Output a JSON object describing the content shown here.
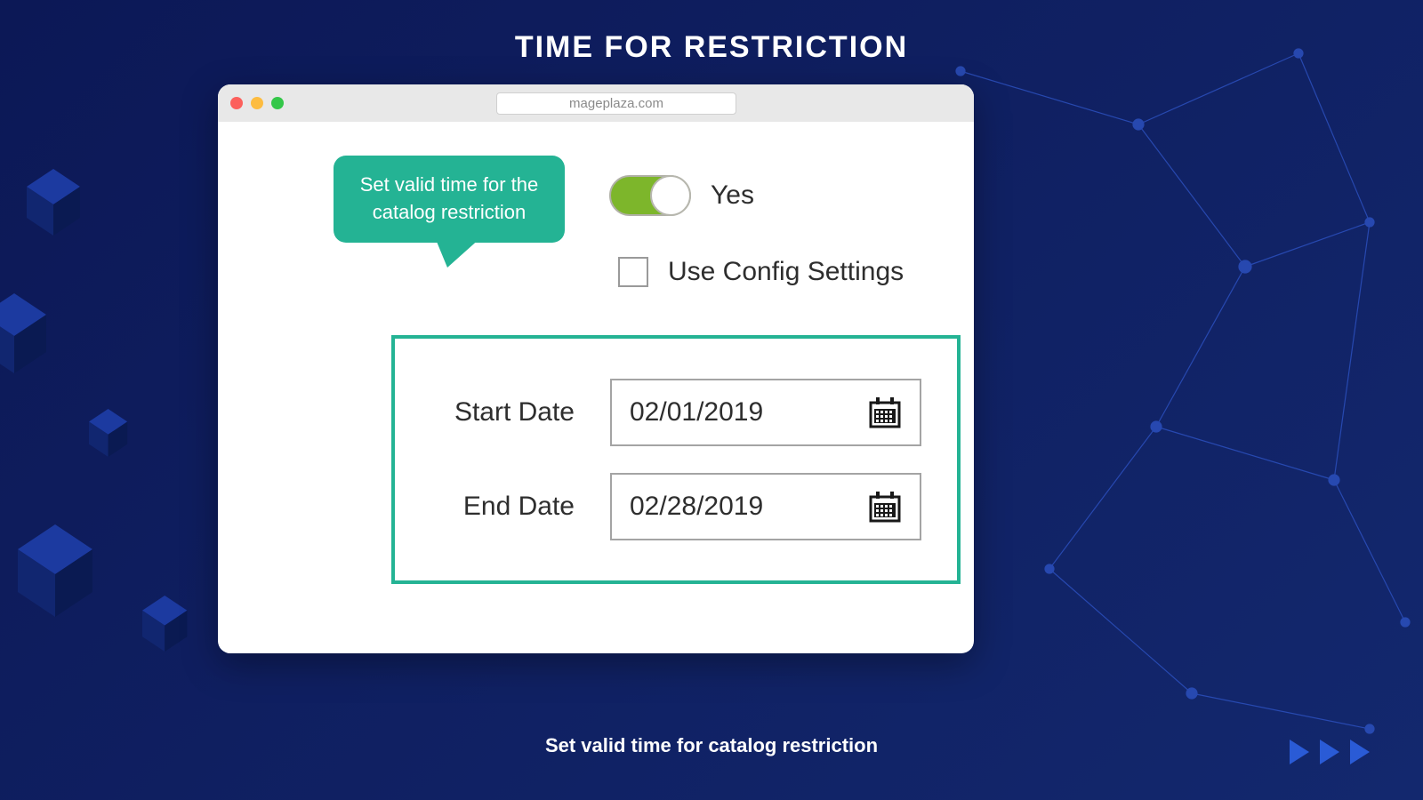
{
  "colors": {
    "background": "#0d1a5c",
    "accent": "#24b394",
    "toggle_on": "#7db62b",
    "text": "#2e2e2e"
  },
  "page": {
    "title": "TIME FOR RESTRICTION",
    "subcaption": "Set valid time for catalog restriction"
  },
  "browser": {
    "url": "mageplaza.com"
  },
  "bubble": {
    "text": "Set valid time for the catalog restriction"
  },
  "toggle": {
    "state": "on",
    "label": "Yes"
  },
  "config_checkbox": {
    "checked": false,
    "label": "Use Config Settings"
  },
  "dates": {
    "start": {
      "label": "Start Date",
      "value": "02/01/2019"
    },
    "end": {
      "label": "End Date",
      "value": "02/28/2019"
    }
  }
}
